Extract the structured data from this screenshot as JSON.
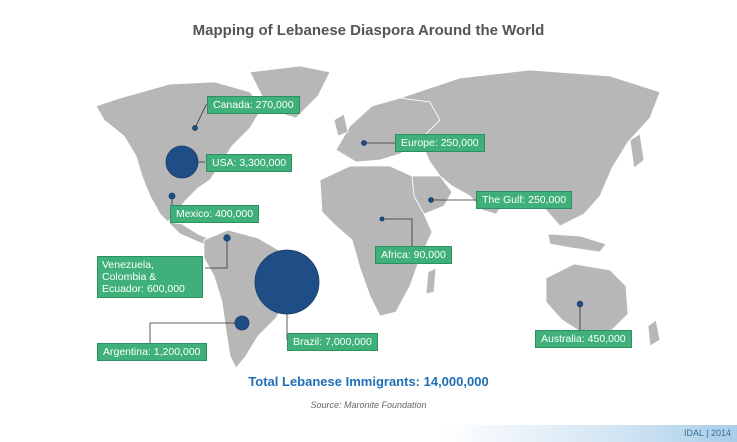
{
  "title": "Mapping of Lebanese Diaspora Around the World",
  "colors": {
    "land": "#b7b7b7",
    "bubble": "#1f4e86",
    "label_bg": "#3fb07a",
    "accent": "#1e6fb5"
  },
  "regions": [
    {
      "key": "canada",
      "label": "Canada: 270,000",
      "population": 270000
    },
    {
      "key": "usa",
      "label": "USA: 3,300,000",
      "population": 3300000
    },
    {
      "key": "mexico",
      "label": "Mexico: 400,000",
      "population": 400000
    },
    {
      "key": "venezuela",
      "label": "Venezuela, Colombia & Ecuador: 600,000",
      "population": 600000
    },
    {
      "key": "brazil",
      "label": "Brazil: 7,000,000",
      "population": 7000000
    },
    {
      "key": "argentina",
      "label": "Argentina: 1,200,000",
      "population": 1200000
    },
    {
      "key": "europe",
      "label": "Europe: 250,000",
      "population": 250000
    },
    {
      "key": "gulf",
      "label": "The Gulf: 250,000",
      "population": 250000
    },
    {
      "key": "africa",
      "label": "Africa: 90,000",
      "population": 90000
    },
    {
      "key": "australia",
      "label": "Australia: 450,000",
      "population": 450000
    }
  ],
  "total": "Total Lebanese Immigrants: 14,000,000",
  "source": "Source: Maronite Foundation",
  "footer": "IDAL | 2014"
}
